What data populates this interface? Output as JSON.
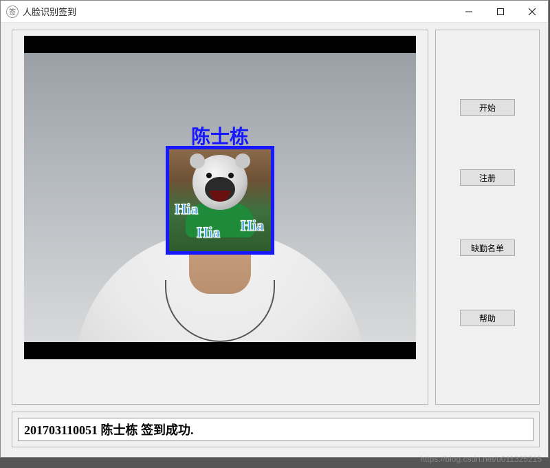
{
  "window": {
    "title": "人脸识别签到",
    "icon_label": "签"
  },
  "recognition": {
    "name": "陈士栋",
    "overlay_words": [
      "Hia",
      "Hia",
      "Hia"
    ]
  },
  "buttons": {
    "start": "开始",
    "register": "注册",
    "absent_list": "缺勤名单",
    "help": "帮助"
  },
  "status": {
    "message": "201703110051 陈士栋 签到成功."
  },
  "colors": {
    "face_box": "#1818ff",
    "name_label": "#1818ff"
  },
  "watermark": "https://blog.csdn.net/u011325215"
}
